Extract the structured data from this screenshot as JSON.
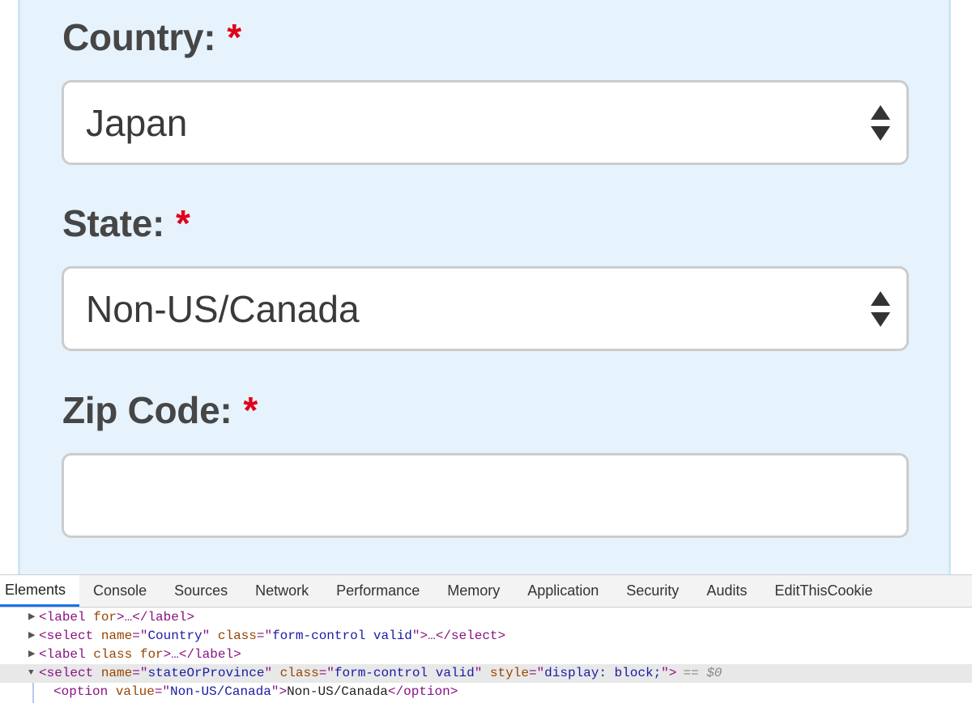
{
  "form": {
    "country": {
      "label": "Country:",
      "required_mark": "*",
      "selected_value": "Japan"
    },
    "state": {
      "label": "State:",
      "required_mark": "*",
      "selected_value": "Non-US/Canada"
    },
    "zip": {
      "label": "Zip Code:",
      "required_mark": "*",
      "value": ""
    }
  },
  "colors": {
    "panel_background": "#e6f3fc",
    "required_mark": "#e0001a",
    "devtools_active_tab": "#1a73e8"
  },
  "devtools": {
    "tabs": [
      "Elements",
      "Console",
      "Sources",
      "Network",
      "Performance",
      "Memory",
      "Application",
      "Security",
      "Audits",
      "EditThisCookie"
    ],
    "active_tab": "Elements",
    "dom": {
      "line1": {
        "open": "<",
        "tag": "label",
        "attr1": " for",
        "rest": ">…</",
        "tag_close": "label",
        "end": ">"
      },
      "line2": {
        "open": "<",
        "tag": "select",
        "attr1": " name",
        "eq1": "=\"",
        "val1": "Country",
        "q1": "\"",
        "attr2": " class",
        "eq2": "=\"",
        "val2": "form-control valid",
        "q2": "\"",
        "rest": ">…</",
        "tag_close": "select",
        "end": ">"
      },
      "line3": {
        "open": "<",
        "tag": "label",
        "attr1": " class",
        "attr2": " for",
        "rest": ">…</",
        "tag_close": "label",
        "end": ">"
      },
      "line4": {
        "open": "<",
        "tag": "select",
        "attr1": " name",
        "eq1": "=\"",
        "val1": "stateOrProvince",
        "q1": "\"",
        "attr2": " class",
        "eq2": "=\"",
        "val2": "form-control valid",
        "q2": "\"",
        "attr3": " style",
        "eq3": "=\"",
        "val3": "display: block;",
        "q3": "\"",
        "end": ">",
        "marker": "==",
        "ref": "$0"
      },
      "line5": {
        "open": "<",
        "tag": "option",
        "attr1": " value",
        "eq1": "=\"",
        "val1": "Non-US/Canada",
        "q1": "\"",
        "mid": ">",
        "text": "Non-US/Canada",
        "close_open": "</",
        "tag_close": "option",
        "end": ">"
      }
    }
  }
}
